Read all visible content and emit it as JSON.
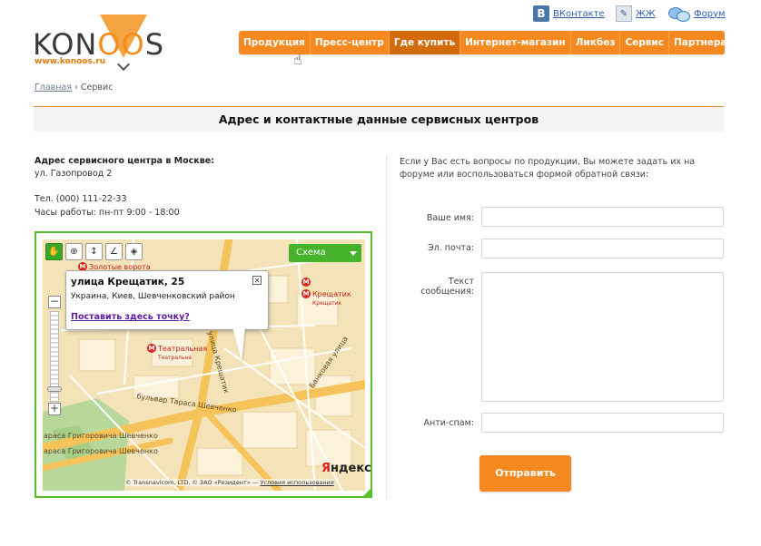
{
  "header": {
    "logo_text_prefix": "KON",
    "logo_text_o2": "O",
    "logo_text_o3": "O",
    "logo_text_suffix": "S",
    "logo_url": "www.konoos.ru",
    "social": {
      "vk_letter": "B",
      "vk_label": "ВКонтакте",
      "lj_label": "ЖЖ",
      "forum_label": "Форум"
    },
    "menu": [
      {
        "label": "Продукция"
      },
      {
        "label": "Пресс-центр"
      },
      {
        "label": "Где купить"
      },
      {
        "label": "Интернет-магазин"
      },
      {
        "label": "Ликбез"
      },
      {
        "label": "Сервис"
      },
      {
        "label": "Партнерам"
      }
    ],
    "active_menu": "Где купить"
  },
  "breadcrumb": {
    "home": "Главная",
    "separator": "›",
    "current": "Сервис"
  },
  "page_title": "Адрес и контактные данные сервисных центров",
  "address": {
    "heading": "Адрес сервисного центра в Москве:",
    "street": "ул. Газопровод 2",
    "phone": "Тел. (000) 111-22-33",
    "hours": "Часы работы: пн-пт 9:00 - 18:00"
  },
  "map": {
    "scheme_label": "Схема",
    "balloon_title": "улица Крещатик, 25",
    "balloon_subtitle": "Украина, Киев, Шевченковский район",
    "balloon_link": "Поставить здесь точку?",
    "metro_1": "Золотые ворота",
    "metro_2": "Крещатик",
    "metro_2_sub": "Крещатик",
    "metro_3": "Театральная",
    "metro_3_sub": "Театральна",
    "street_1": "бульвар Тараса Шевченко",
    "street_2": "араса Григоровича Шевченко",
    "street_3": "араса Григоровича Шевченко",
    "street_4": "Банковая улица",
    "street_5": "улица Крещатик",
    "yandex_y": "Я",
    "yandex_rest": "ндекс",
    "copyright_text": "© Transnavicom, LTD, © ЗАО «Резидент» —",
    "copyright_link": "Условия использования",
    "zoom_in": "+",
    "zoom_out": "−"
  },
  "form": {
    "intro": "Если у Вас есть вопросы по продукции, Вы можете задать их на форуме или воспользоваться формой обратной связи:",
    "name_label": "Ваше имя:",
    "email_label": "Эл. почта:",
    "message_label": "Текст сообщения:",
    "antispam_label": "Анти-спам:",
    "submit_label": "Отправить"
  },
  "colors": {
    "accent": "#f5891f",
    "map_border": "#55c22c",
    "link": "#2a5db0"
  }
}
